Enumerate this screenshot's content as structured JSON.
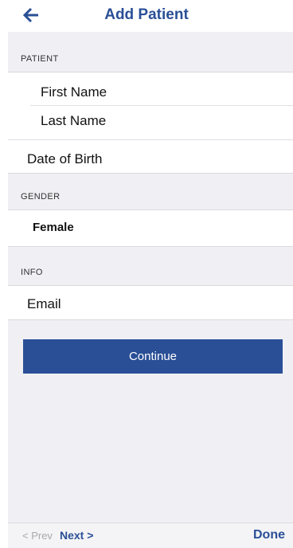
{
  "header": {
    "title": "Add Patient",
    "back_icon": "arrow-left-icon"
  },
  "sections": {
    "patient_label": "PATIENT",
    "gender_label": "GENDER",
    "info_label": "INFO"
  },
  "fields": {
    "first_name_placeholder": "First Name",
    "last_name_placeholder": "Last Name",
    "dob_placeholder": "Date of Birth",
    "email_placeholder": "Email"
  },
  "gender": {
    "value": "Female"
  },
  "actions": {
    "continue_label": "Continue"
  },
  "toolbar": {
    "prev_label": "< Prev",
    "next_label": "Next >",
    "done_label": "Done"
  },
  "colors": {
    "brand": "#2a4f96",
    "background": "#efeff4"
  }
}
